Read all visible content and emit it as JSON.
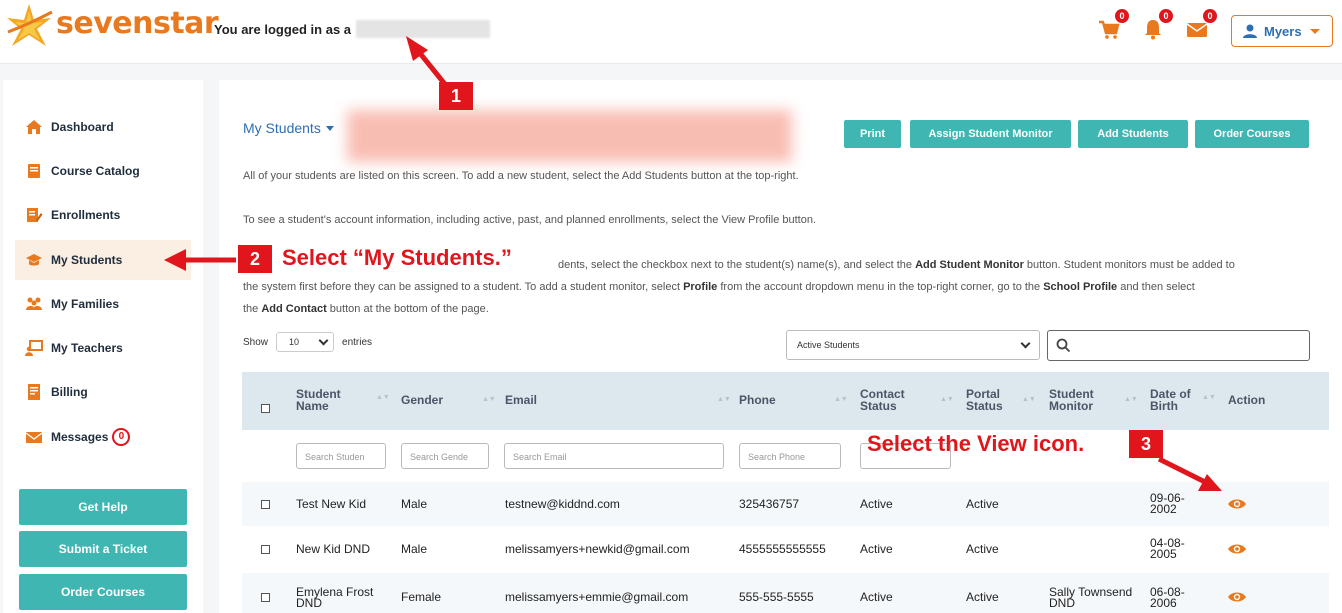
{
  "app": {
    "brand": "sevenstar",
    "logged_in_text": "You are logged in as a",
    "cart_count": "0",
    "notifications_count": "0",
    "messages_count": "0",
    "user_name": "Myers"
  },
  "sidebar": {
    "items": [
      {
        "label": "Dashboard"
      },
      {
        "label": "Course Catalog"
      },
      {
        "label": "Enrollments"
      },
      {
        "label": "My Students"
      },
      {
        "label": "My Families"
      },
      {
        "label": "My Teachers"
      },
      {
        "label": "Billing"
      },
      {
        "label": "Messages",
        "badge": "0"
      }
    ],
    "buttons": [
      "Get Help",
      "Submit a Ticket",
      "Order Courses"
    ]
  },
  "main": {
    "title": "My Students",
    "buttons": [
      "Print",
      "Assign Student Monitor",
      "Add Students",
      "Order Courses"
    ],
    "para1": "All of your students are listed on this screen. To add a new student, select the Add Students button at the top-right.",
    "para2": "To see a student's account information, including active, past, and planned enrollments, select the View Profile button.",
    "para3": {
      "a": "dents, select the checkbox next to the student(s) name(s), and select the ",
      "b": "Add Student Monitor",
      "c": " button. Student monitors must be added to",
      "d": "the system first before they can be assigned to a student. To add a student monitor, select ",
      "e": "Profile",
      "f": " from the account dropdown menu in the top-right corner, go to the ",
      "g": "School Profile",
      "h": " and then select",
      "i": "the ",
      "j": "Add Contact",
      "k": " button at the bottom of the page."
    },
    "show_label": "Show",
    "entries_value": "10",
    "entries_label": "entries",
    "status_filter": "Active Students"
  },
  "table": {
    "headers": {
      "student_name": [
        "Student",
        "Name"
      ],
      "gender": "Gender",
      "email": "Email",
      "phone": "Phone",
      "contact_status": [
        "Contact",
        "Status"
      ],
      "portal_status": [
        "Portal",
        "Status"
      ],
      "student_monitor": [
        "Student",
        "Monitor"
      ],
      "dob": [
        "Date of",
        "Birth"
      ],
      "action": "Action"
    },
    "filters": [
      "Search Studen",
      "Search Gende",
      "Search Email",
      "Search Phone"
    ],
    "rows": [
      {
        "name": [
          "Test New Kid"
        ],
        "gender": "Male",
        "email": "testnew@kiddnd.com",
        "phone": "325436757",
        "contact": "Active",
        "portal": "Active",
        "monitor": [],
        "dob": [
          "09-06-",
          "2002"
        ]
      },
      {
        "name": [
          "New Kid DND"
        ],
        "gender": "Male",
        "email": "melissamyers+newkid@gmail.com",
        "phone": "4555555555555",
        "contact": "Active",
        "portal": "Active",
        "monitor": [],
        "dob": [
          "04-08-",
          "2005"
        ]
      },
      {
        "name": [
          "Emylena Frost",
          "DND"
        ],
        "gender": "Female",
        "email": "melissamyers+emmie@gmail.com",
        "phone": "555-555-5555",
        "contact": "Active",
        "portal": "Active",
        "monitor": [
          "Sally Townsend",
          "DND"
        ],
        "dob": [
          "06-08-",
          "2006"
        ]
      }
    ]
  },
  "annotations": {
    "step1": "1",
    "step2": "2",
    "step2_text": "Select “My Students.”",
    "step3": "3",
    "step3_text": "Select the View icon.",
    "color": "#e0161c"
  },
  "colors": {
    "accent_orange": "#e8791f",
    "teal_button": "#40b6b2",
    "link_blue": "#2d6fb3",
    "active_nav_bg": "#fbeee2"
  }
}
